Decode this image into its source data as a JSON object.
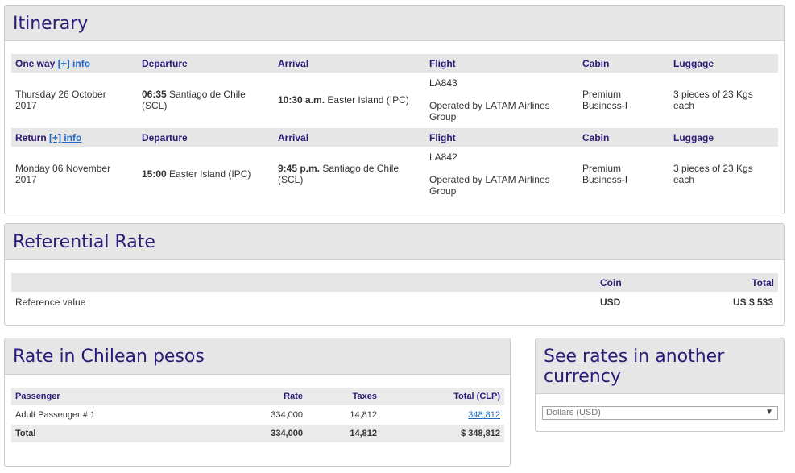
{
  "itinerary": {
    "title": "Itinerary",
    "outbound": {
      "header": {
        "direction": "One way",
        "info_link": "[+] info",
        "departure": "Departure",
        "arrival": "Arrival",
        "flight": "Flight",
        "cabin": "Cabin",
        "luggage": "Luggage"
      },
      "date": "Thursday 26 October 2017",
      "dep_time": "06:35",
      "dep_place": "Santiago de Chile (SCL)",
      "arr_time": "10:30 a.m.",
      "arr_place": "Easter Island (IPC)",
      "flight_number": "LA843",
      "operated_by": "Operated by LATAM Airlines Group",
      "cabin": "Premium Business-I",
      "luggage": "3 pieces of 23 Kgs each"
    },
    "return": {
      "header": {
        "direction": "Return",
        "info_link": "[+] info",
        "departure": "Departure",
        "arrival": "Arrival",
        "flight": "Flight",
        "cabin": "Cabin",
        "luggage": "Luggage"
      },
      "date": "Monday 06 November 2017",
      "dep_time": "15:00",
      "dep_place": "Easter Island (IPC)",
      "arr_time": "9:45 p.m.",
      "arr_place": "Santiago de Chile (SCL)",
      "flight_number": "LA842",
      "operated_by": "Operated by LATAM Airlines Group",
      "cabin": "Premium Business-I",
      "luggage": "3 pieces of 23 Kgs each"
    }
  },
  "referential": {
    "title": "Referential Rate",
    "col_coin": "Coin",
    "col_total": "Total",
    "row_label": "Reference value",
    "coin": "USD",
    "total": "US $ 533"
  },
  "clp": {
    "title": "Rate in Chilean pesos",
    "headers": {
      "passenger": "Passenger",
      "rate": "Rate",
      "taxes": "Taxes",
      "total": "Total (CLP)"
    },
    "rows": [
      {
        "passenger": "Adult Passenger # 1",
        "rate": "334,000",
        "taxes": "14,812",
        "total": "348,812"
      }
    ],
    "footer": {
      "label": "Total",
      "rate": "334,000",
      "taxes": "14,812",
      "total": "$ 348,812"
    }
  },
  "currency": {
    "title": "See rates in another currency",
    "selected": "Dollars (USD)"
  },
  "colors": {
    "heading": "#2d1a78",
    "link": "#1f6ac2",
    "header_bg": "#e6e6e6"
  }
}
